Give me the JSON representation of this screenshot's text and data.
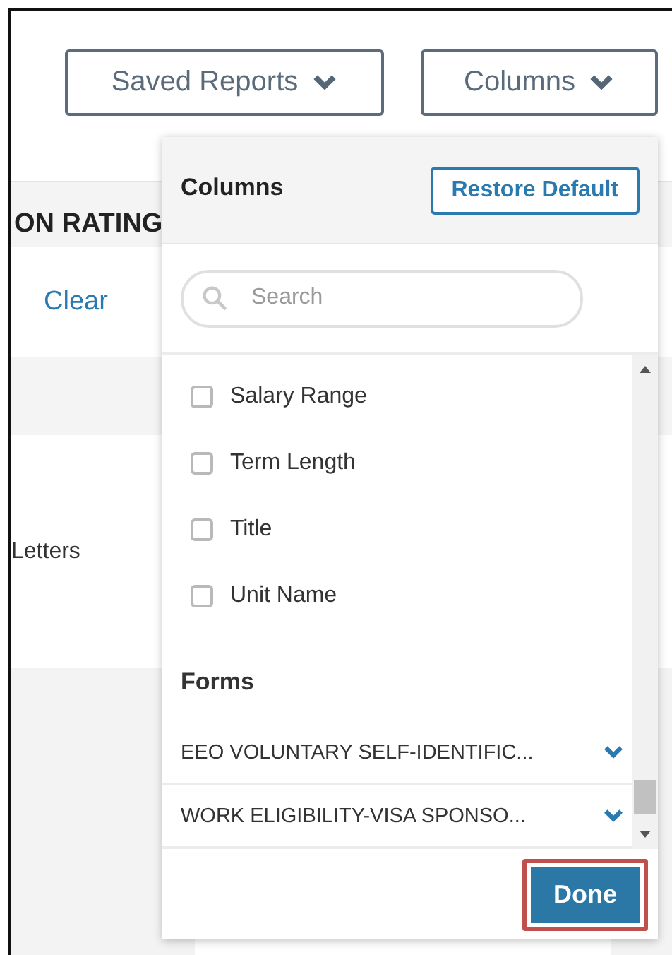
{
  "toolbar": {
    "buttons": [
      {
        "label": "Saved Reports"
      },
      {
        "label": "Columns"
      }
    ]
  },
  "table": {
    "header": "ON RATING",
    "clear_link": "Clear",
    "cell": "Letters"
  },
  "columns_panel": {
    "title": "Columns",
    "restore_button": "Restore Default",
    "search": {
      "placeholder": "Search"
    },
    "items": [
      {
        "label": "Salary Range",
        "checked": false
      },
      {
        "label": "Term Length",
        "checked": false
      },
      {
        "label": "Title",
        "checked": false
      },
      {
        "label": "Unit Name",
        "checked": false
      }
    ],
    "forms_heading": "Forms",
    "forms": [
      {
        "label": "EEO VOLUNTARY SELF-IDENTIFIC...",
        "expanded": false
      },
      {
        "label": "WORK ELIGIBILITY-VISA SPONSO...",
        "expanded": false
      }
    ],
    "done_button": {
      "label": "Done",
      "highlighted": true
    }
  }
}
